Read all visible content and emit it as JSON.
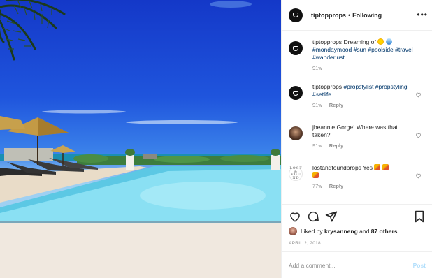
{
  "post": {
    "username": "tiptopprops",
    "follow_label": "Following",
    "more_icon": "more-options-icon"
  },
  "comments": [
    {
      "user": "tiptopprops",
      "text": "Dreaming of",
      "emojis": [
        "sun-emoji",
        "wave-emoji"
      ],
      "hashtags": "#mondaymood #sun #poolside #travel #wanderlust",
      "time": "91w",
      "reply": ""
    },
    {
      "user": "tiptopprops",
      "text": "",
      "hashtags": "#propstylist #propstyling #setlife",
      "time": "91w",
      "reply": "Reply"
    },
    {
      "user": "jbeannie",
      "text": "Gorge! Where was that taken?",
      "hashtags": "",
      "time": "91w",
      "reply": "Reply"
    },
    {
      "user": "lostandfoundprops",
      "text": "Yes",
      "emojis": [
        "party-popper-emoji",
        "party-popper-emoji",
        "party-popper-emoji"
      ],
      "hashtags": "",
      "time": "77w",
      "reply": "Reply"
    }
  ],
  "lost_avatar_text": [
    "L O S T",
    "&",
    "F O U N D"
  ],
  "likes": {
    "prefix": "Liked by",
    "user": "krysanneng",
    "middle": "and",
    "others": "87 others"
  },
  "date": "APRIL 2, 2018",
  "add_comment": {
    "placeholder": "Add a comment...",
    "post_label": "Post"
  },
  "colors": {
    "link": "#00376b",
    "muted": "#8e8e8e",
    "post_disabled": "#b2dffc"
  }
}
